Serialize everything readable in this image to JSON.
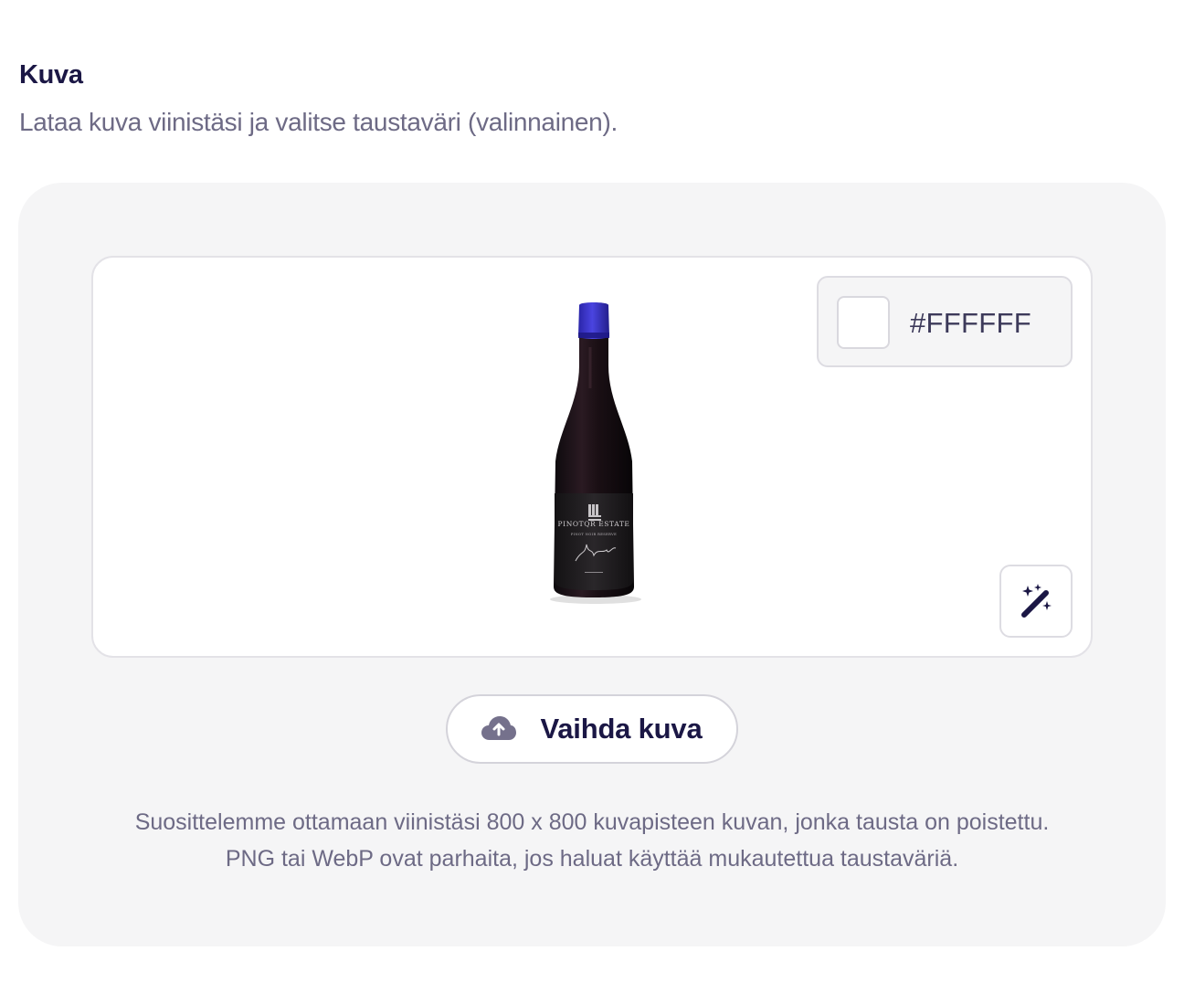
{
  "section": {
    "title": "Kuva",
    "description": "Lataa kuva viinistäsi ja valitse taustaväri (valinnainen)."
  },
  "preview": {
    "image_alt": "wine-bottle",
    "bottle_label_brand": "PINOTQR ESTATE",
    "bottle_label_sub": "PINOT NOIR RESERVE",
    "background_color": "#FFFFFF",
    "background_hex_label": "#FFFFFF",
    "magic_icon": "magic-wand-icon"
  },
  "actions": {
    "change_image_label": "Vaihda kuva",
    "change_image_icon": "cloud-upload-icon"
  },
  "hint": {
    "line1": "Suosittelemme ottamaan viinistäsi 800 x 800 kuvapisteen kuvan, jonka tausta on poistettu.",
    "line2": "PNG tai WebP ovat parhaita, jos haluat käyttää mukautettua taustaväriä."
  },
  "colors": {
    "accent": "#1b1745",
    "muted_text": "#6d6a85",
    "panel_bg": "#f5f5f6",
    "bottle_cap": "#3b35c9"
  }
}
